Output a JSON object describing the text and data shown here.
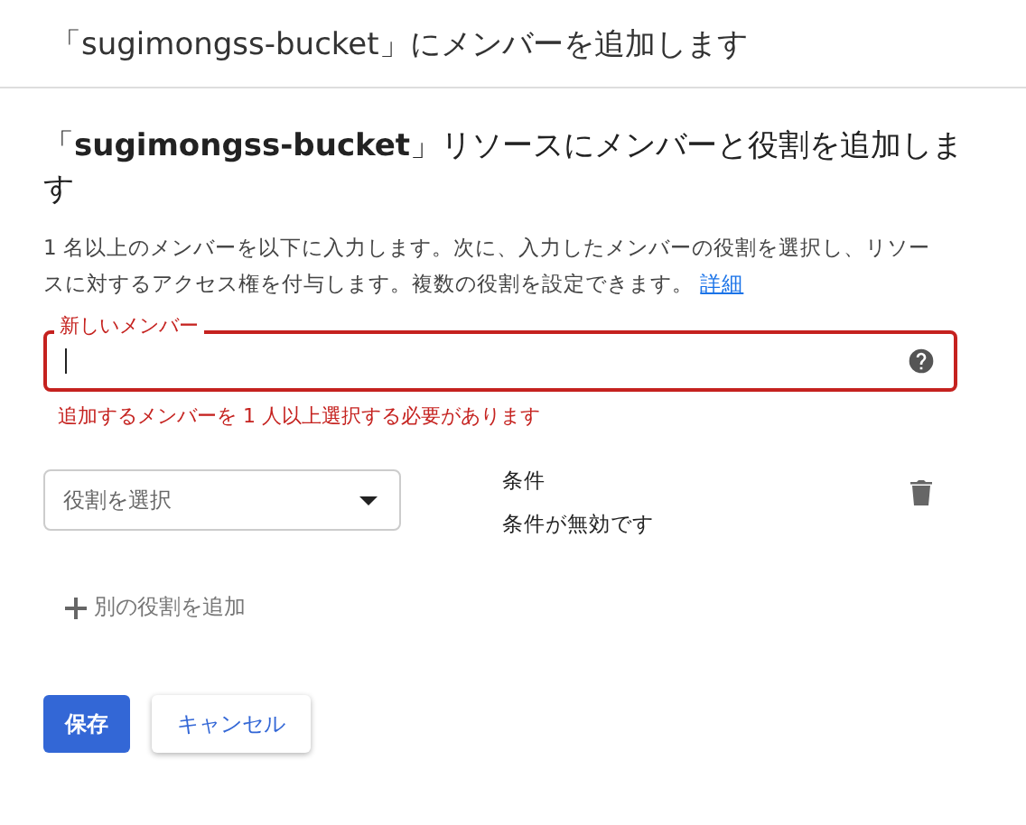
{
  "dialog_title": "「sugimongss-bucket」にメンバーを追加します",
  "heading": "「**sugimongss-bucket**」リソースにメンバーと役割を追加します",
  "description": "1 名以上のメンバーを以下に入力します。次に、入力したメンバーの役割を選択し、リソースに対するアクセス権を付与します。複数の役割を設定できます。",
  "details_link": "詳細",
  "member_field": {
    "label": "新しいメンバー",
    "error": true,
    "error_message": "追加するメンバーを 1 人以上選択する必要があります"
  },
  "role_select": {
    "placeholder": "役割を選択"
  },
  "condition": {
    "label": "条件",
    "value": "条件が無効です"
  },
  "add_role": "別の役割を追加",
  "buttons": [
    {
      "label": "保存",
      "kind": "primary"
    },
    {
      "label": "キャンセル",
      "kind": "secondary"
    }
  ]
}
